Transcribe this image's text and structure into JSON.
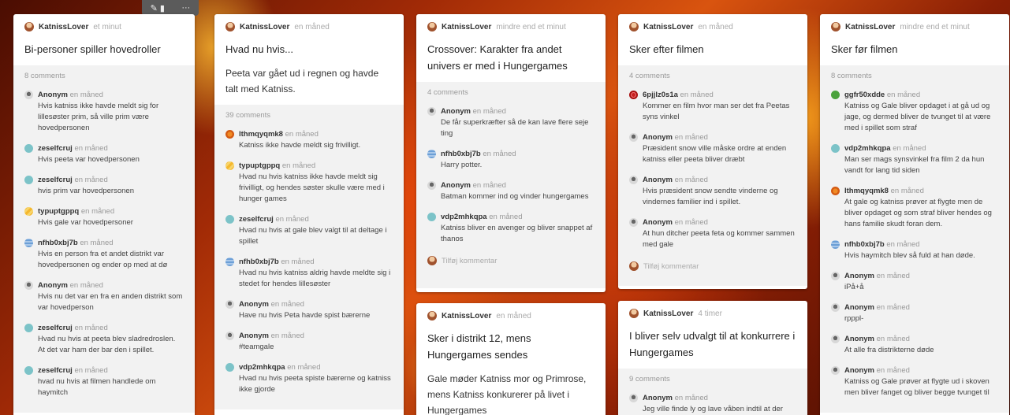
{
  "colors": {
    "accent": "#f08a24",
    "panel_bg": "#f2f2f2"
  },
  "toolbar": {
    "icons": [
      "edit-icon",
      "more-icon"
    ],
    "more_label": "···",
    "edit_label": "✎ ▮"
  },
  "cards": [
    {
      "author": "KatnissLover",
      "time": "et minut",
      "title": "Bi-personer spiller hovedroller",
      "comment_count": "8 comments",
      "comments": [
        {
          "author": "Anonym",
          "time": "en måned",
          "text": "Hvis katniss ikke havde meldt sig for lillesøster prim, så ville prim være hovedpersonen"
        },
        {
          "author": "zeselfcruj",
          "time": "en måned",
          "text": "Hvis peeta var hovedpersonen"
        },
        {
          "author": "zeselfcruj",
          "time": "en måned",
          "text": "hvis prim var hovedpersonen"
        },
        {
          "author": "typuptgppq",
          "time": "en måned",
          "text": "Hvis gale var hovedpersoner"
        },
        {
          "author": "nfhb0xbj7b",
          "time": "en måned",
          "text": "Hvis en person fra et andet distrikt var hovedpersonen og ender op med at dø"
        },
        {
          "author": "Anonym",
          "time": "en måned",
          "text": "Hvis nu det var en fra en anden distrikt som var hovedperson"
        },
        {
          "author": "zeselfcruj",
          "time": "en måned",
          "text": "Hvad nu hvis at peeta blev sladredroslen. At det var ham der bar den i spillet."
        },
        {
          "author": "zeselfcruj",
          "time": "en måned",
          "text": "hvad nu hvis at filmen handlede om haymitch"
        }
      ]
    },
    {
      "author": "KatnissLover",
      "time": "en måned",
      "title": "Hvad nu hvis...",
      "text": "Peeta var gået ud i regnen og havde talt med Katniss.",
      "comment_count": "39 comments",
      "comments": [
        {
          "author": "lthmqyqmk8",
          "time": "en måned",
          "text": "Katniss ikke havde meldt sig frivilligt."
        },
        {
          "author": "typuptgppq",
          "time": "en måned",
          "text": "Hvad nu hvis katniss ikke havde meldt sig frivilligt, og hendes søster skulle være med i hunger games"
        },
        {
          "author": "zeselfcruj",
          "time": "en måned",
          "text": "Hvad nu hvis at gale blev valgt til at deltage i spillet"
        },
        {
          "author": "nfhb0xbj7b",
          "time": "en måned",
          "text": "Hvad nu hvis katniss aldrig havde meldte sig i stedet for hendes lillesøster"
        },
        {
          "author": "Anonym",
          "time": "en måned",
          "text": "Have nu hvis Peta havde spist bærerne"
        },
        {
          "author": "Anonym",
          "time": "en måned",
          "text": "#teamgale"
        },
        {
          "author": "vdp2mhkqpa",
          "time": "en måned",
          "text": "Hvad nu hvis peeta spiste bærerne og katniss ikke gjorde"
        }
      ]
    },
    {
      "author": "KatnissLover",
      "time": "mindre end et minut",
      "title": "Crossover: Karakter fra andet univers er med i Hungergames",
      "comment_count": "4 comments",
      "comments": [
        {
          "author": "Anonym",
          "time": "en måned",
          "text": "De får superkræfter så de kan lave flere seje ting"
        },
        {
          "author": "nfhb0xbj7b",
          "time": "en måned",
          "text": "Harry potter."
        },
        {
          "author": "Anonym",
          "time": "en måned",
          "text": "Batman kommer ind og vinder hungergames"
        },
        {
          "author": "vdp2mhkqpa",
          "time": "en måned",
          "text": "Katniss bliver en avenger og bliver snappet af thanos"
        }
      ],
      "add_comment": "Tilføj kommentar"
    },
    {
      "author": "KatnissLover",
      "time": "en måned",
      "title": "Sker i distrikt 12, mens Hungergames sendes",
      "text": "Gale møder Katniss mor og Primrose, mens Katniss konkurerer på livet i Hungergames"
    },
    {
      "author": "KatnissLover",
      "time": "en måned",
      "title": "Sker efter filmen",
      "comment_count": "4 comments",
      "comments": [
        {
          "author": "6pjjlz0s1a",
          "time": "en måned",
          "text": "Kommer en film hvor man ser det fra Peetas syns vinkel"
        },
        {
          "author": "Anonym",
          "time": "en måned",
          "text": "Præsident snow ville måske ordre at enden katniss eller peeta bliver dræbt"
        },
        {
          "author": "Anonym",
          "time": "en måned",
          "text": "Hvis præsident snow sendte vinderne og vindernes familier ind i spillet."
        },
        {
          "author": "Anonym",
          "time": "en måned",
          "text": "At hun ditcher peeta feta og kommer sammen med gale"
        }
      ],
      "add_comment": "Tilføj kommentar"
    },
    {
      "author": "KatnissLover",
      "time": "4 timer",
      "title": "I bliver selv udvalgt til at konkurrere i Hungergames",
      "comment_count": "9 comments",
      "comments": [
        {
          "author": "Anonym",
          "time": "en måned",
          "text": "Jeg ville finde ly og lave våben indtil at der"
        }
      ]
    },
    {
      "author": "KatnissLover",
      "time": "mindre end et minut",
      "title": "Sker før filmen",
      "comment_count": "8 comments",
      "comments": [
        {
          "author": "ggfr50xdde",
          "time": "en måned",
          "text": "Katniss og Gale bliver opdaget i at gå ud og jage, og dermed bliver de tvunget til at være med i spillet som straf"
        },
        {
          "author": "vdp2mhkqpa",
          "time": "en måned",
          "text": "Man ser mags synsvinkel fra film 2 da hun vandt for lang tid siden"
        },
        {
          "author": "lthmqyqmk8",
          "time": "en måned",
          "text": "At gale og katniss prøver at flygte men de bliver opdaget og som straf bliver hendes og hans familie skudt foran dem."
        },
        {
          "author": "nfhb0xbj7b",
          "time": "en måned",
          "text": "Hvis haymitch blev så fuld at han døde."
        },
        {
          "author": "Anonym",
          "time": "en måned",
          "text": "iPå+å"
        },
        {
          "author": "Anonym",
          "time": "en måned",
          "text": "rpppl-"
        },
        {
          "author": "Anonym",
          "time": "en måned",
          "text": "At alle fra distrikterne døde"
        },
        {
          "author": "Anonym",
          "time": "en måned",
          "text": "Katniss og Gale prøver at flygte ud i skoven men bliver fanget og bliver begge tvunget til"
        }
      ]
    }
  ]
}
